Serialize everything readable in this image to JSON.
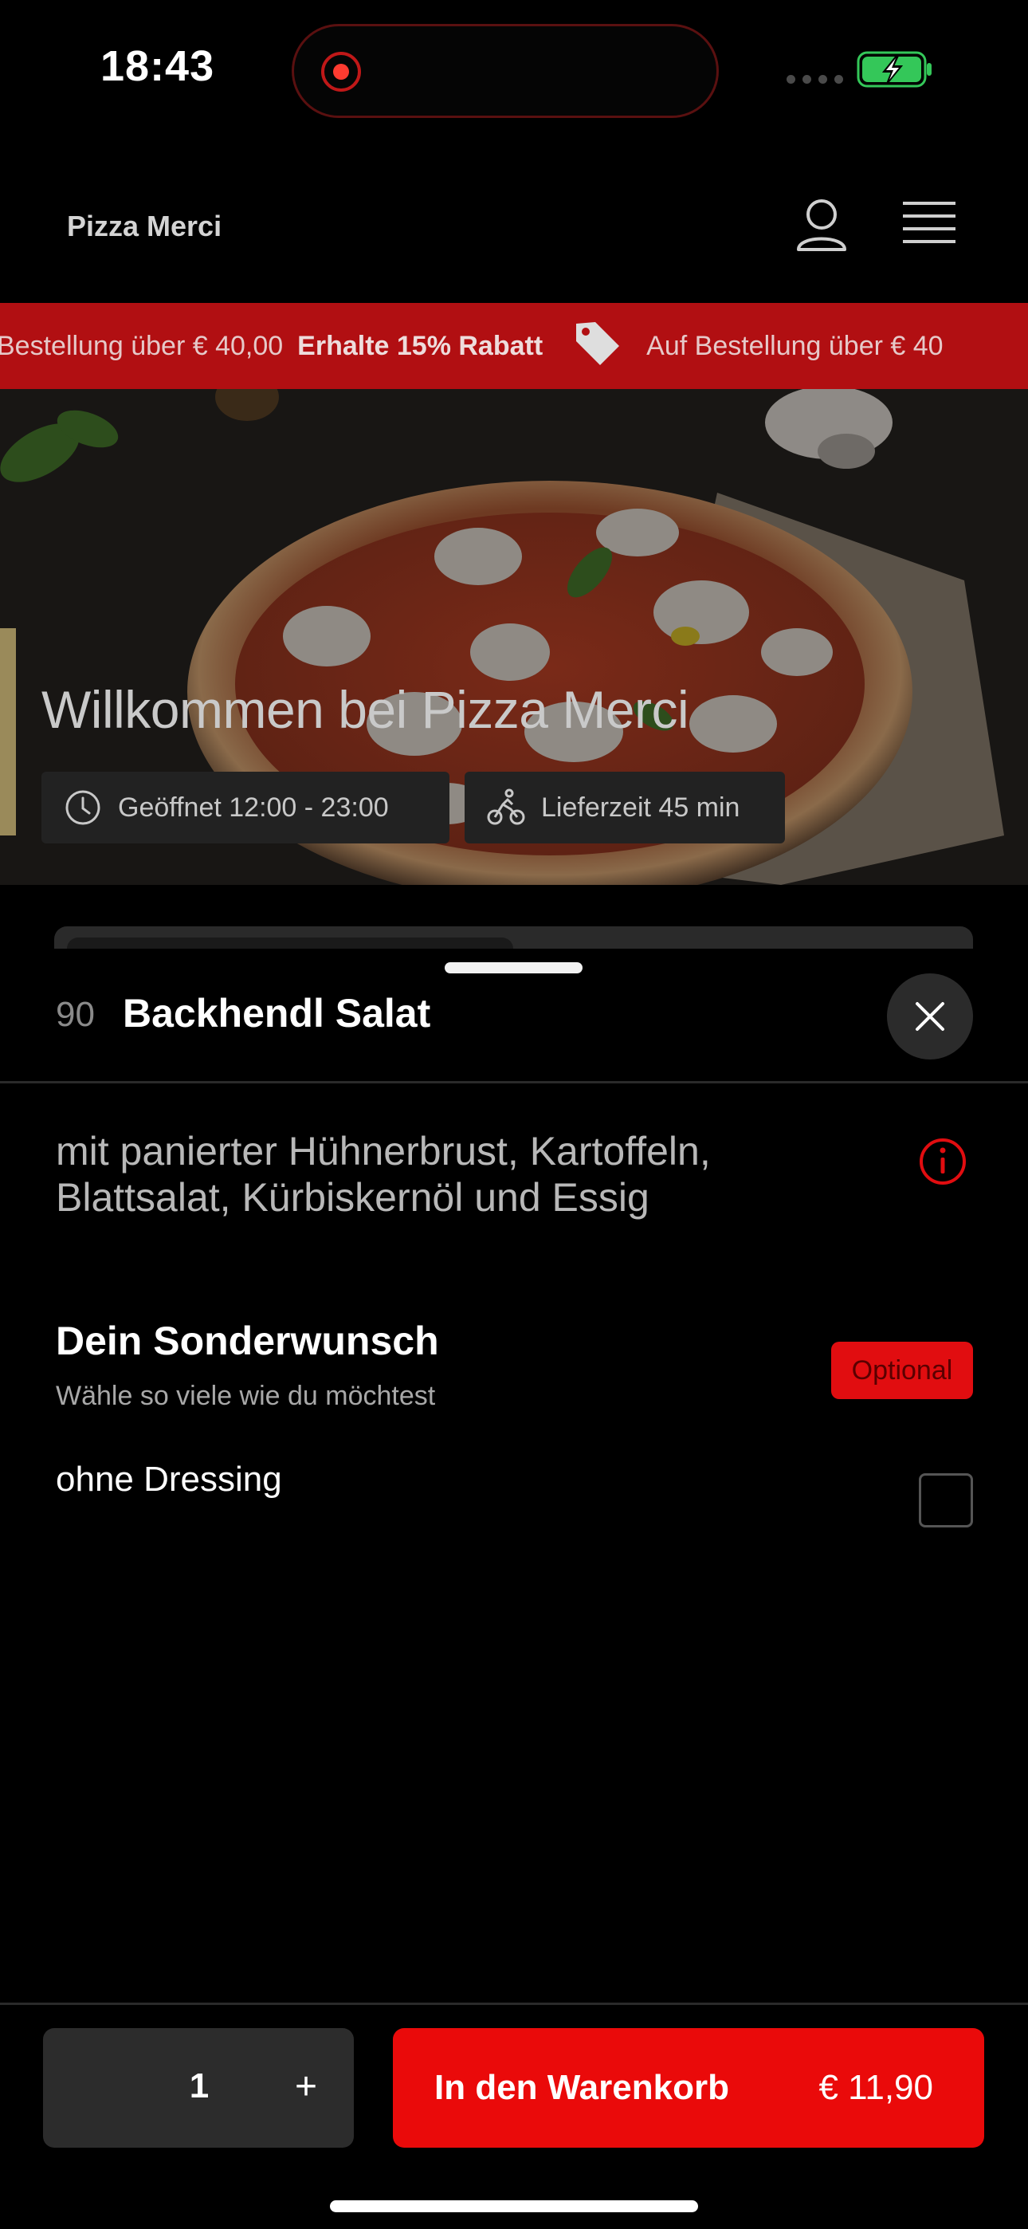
{
  "status_bar": {
    "time": "18:43"
  },
  "header": {
    "brand": "Pizza Merci",
    "icons": [
      "user-icon",
      "menu-icon"
    ]
  },
  "promo": {
    "text_before": "Bestellung über € 40,00",
    "bold": "Erhalte 15% Rabatt",
    "text_after": "Auf Bestellung über € 40"
  },
  "hero": {
    "title": "Willkommen bei Pizza Merci",
    "opening_hours": "Geöffnet 12:00 - 23:00",
    "delivery_time": "Lieferzeit 45 min"
  },
  "item": {
    "number": "90",
    "name": "Backhendl Salat",
    "description": "mit panierter Hühnerbrust, Kartoffeln, Blattsalat, Kürbiskernöl und Essig"
  },
  "options": {
    "title": "Dein Sonderwunsch",
    "subtitle": "Wähle so viele wie du möchtest",
    "badge": "Optional",
    "items": [
      {
        "label": "ohne Dressing",
        "checked": false
      }
    ]
  },
  "footer": {
    "quantity": "1",
    "plus": "+",
    "cart_label": "In den Warenkorb",
    "price": "€ 11,90"
  },
  "colors": {
    "accent_red": "#ea0a0a",
    "promo_red": "#b10f12",
    "battery_green": "#34c759"
  }
}
